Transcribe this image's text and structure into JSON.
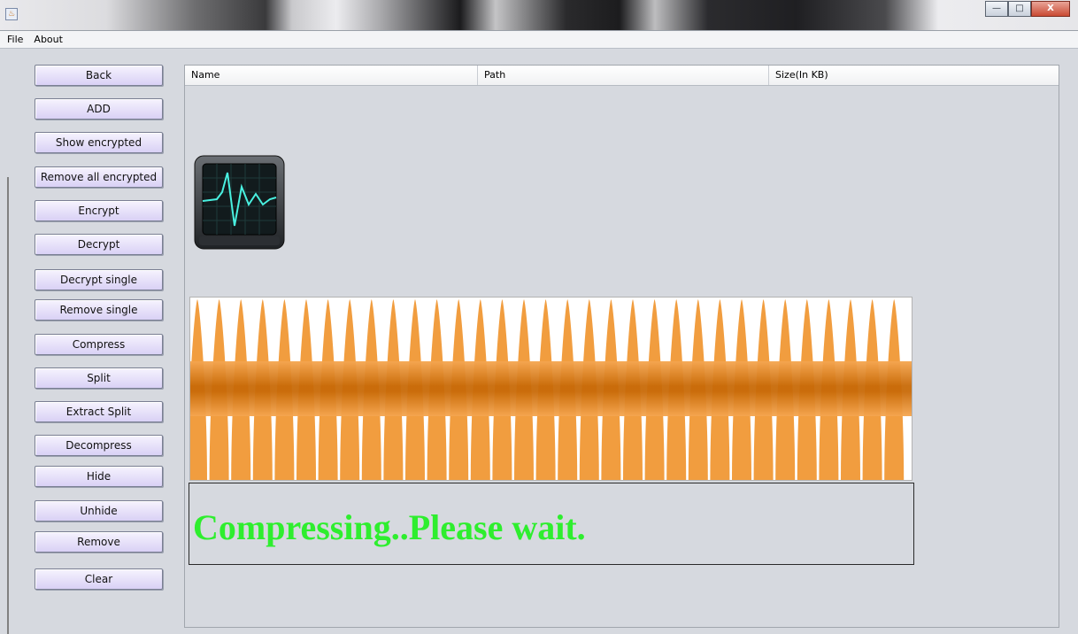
{
  "window": {
    "app_icon_glyph": "♨",
    "controls": {
      "minimize": "—",
      "maximize": "□",
      "close": "X"
    }
  },
  "menu": {
    "items": [
      "File",
      "About"
    ]
  },
  "sidebar": {
    "buttons": [
      {
        "id": "back",
        "label": "Back"
      },
      {
        "id": "add",
        "label": "ADD"
      },
      {
        "id": "show-encrypted",
        "label": "Show encrypted"
      },
      {
        "id": "remove-all-encrypted",
        "label": "Remove all encrypted"
      },
      {
        "id": "encrypt",
        "label": "Encrypt"
      },
      {
        "id": "decrypt",
        "label": "Decrypt"
      },
      {
        "id": "decrypt-single",
        "label": "Decrypt single"
      },
      {
        "id": "remove-single",
        "label": "Remove single"
      },
      {
        "id": "compress",
        "label": "Compress"
      },
      {
        "id": "split",
        "label": "Split"
      },
      {
        "id": "extract-split",
        "label": "Extract Split"
      },
      {
        "id": "decompress",
        "label": "Decompress"
      },
      {
        "id": "hide",
        "label": "Hide"
      },
      {
        "id": "unhide",
        "label": "Unhide"
      },
      {
        "id": "remove",
        "label": "Remove"
      },
      {
        "id": "clear",
        "label": "Clear"
      }
    ]
  },
  "table": {
    "columns": [
      "Name",
      "Path",
      "Size(In KB)"
    ]
  },
  "status": {
    "message": "Compressing..Please wait.",
    "color": "#2eee2e"
  },
  "colors": {
    "wave_orange": "#f0922a",
    "wave_band": "#c86a08",
    "monitor_trace": "#49f0e0"
  },
  "icons": [
    "app-icon",
    "activity-monitor-icon",
    "wave-progress-animation"
  ]
}
